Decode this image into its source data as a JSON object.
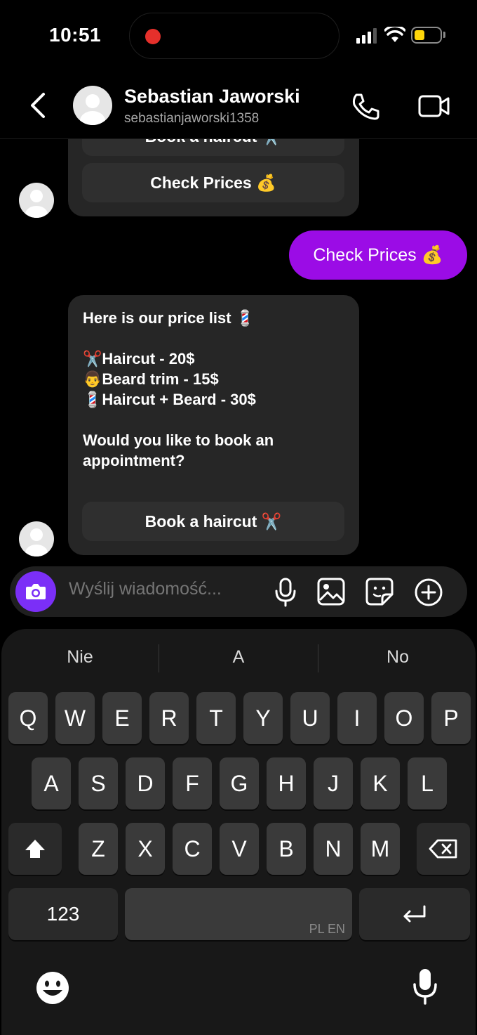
{
  "status": {
    "time": "10:51"
  },
  "header": {
    "name": "Sebastian Jaworski",
    "handle": "sebastianjaworski1358"
  },
  "messages": {
    "first_bubble": {
      "partial_button": "Book a haircut ✂️",
      "button": "Check Prices 💰"
    },
    "outgoing": "Check Prices 💰",
    "price_list": {
      "text": "Here is our price list 💈\n\n✂️Haircut - 20$\n👨Beard trim - 15$\n💈Haircut + Beard - 30$\n\nWould you like to book an appointment?",
      "button": "Book a haircut ✂️"
    }
  },
  "composer": {
    "placeholder": "Wyślij wiadomość..."
  },
  "keyboard": {
    "suggestions": [
      "Nie",
      "A",
      "No"
    ],
    "row1": [
      "Q",
      "W",
      "E",
      "R",
      "T",
      "Y",
      "U",
      "I",
      "O",
      "P"
    ],
    "row2": [
      "A",
      "S",
      "D",
      "F",
      "G",
      "H",
      "J",
      "K",
      "L"
    ],
    "row3": [
      "Z",
      "X",
      "C",
      "V",
      "B",
      "N",
      "M"
    ],
    "numbers_key": "123",
    "space_lang": "PL EN"
  },
  "colors": {
    "outgoing_bubble": "#9b0ce6",
    "camera_button": "#7b2ff7",
    "recording_dot": "#e5302b",
    "battery": "#ffd60a"
  },
  "icons": [
    "back-chevron-icon",
    "phone-icon",
    "video-icon",
    "camera-icon",
    "mic-icon",
    "gallery-icon",
    "sticker-icon",
    "plus-icon",
    "shift-icon",
    "backspace-icon",
    "return-icon",
    "emoji-icon",
    "dictation-icon"
  ]
}
